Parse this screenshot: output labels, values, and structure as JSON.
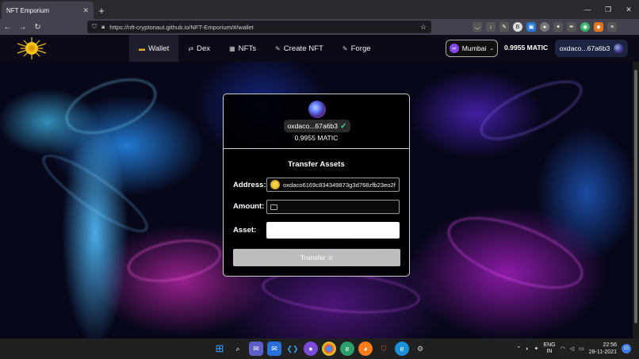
{
  "browser": {
    "tab_title": "NFT Emporium",
    "tab_close": "✕",
    "new_tab": "+",
    "url": "https://nft-cryptonaut.github.io/NFT-Emporium/#/wallet",
    "window_controls": {
      "minimize": "—",
      "restore": "❐",
      "close": "✕"
    },
    "nav": {
      "back": "←",
      "forward": "→",
      "reload": "↻"
    }
  },
  "header": {
    "menu": [
      {
        "label": "Wallet",
        "icon": "wallet-icon",
        "glyph": "▬"
      },
      {
        "label": "Dex",
        "icon": "swap-icon",
        "glyph": "⇄"
      },
      {
        "label": "NFTs",
        "icon": "image-icon",
        "glyph": "▦"
      },
      {
        "label": "Create NFT",
        "icon": "pencil-icon",
        "glyph": "✎"
      },
      {
        "label": "Forge",
        "icon": "pencil-icon",
        "glyph": "✎"
      }
    ],
    "network": "Mumbai",
    "balance": "0.9955 MATIC",
    "account": "oxdaco...67a6b3"
  },
  "wallet_card": {
    "address_short": "oxdaco...67a6b3",
    "balance": "0.9955 MATIC",
    "title": "Transfer Assets",
    "address_label": "Address:",
    "address_value": "oxdaco6169c834349873g3d768zfb23eo2f",
    "amount_label": "Amount:",
    "amount_value": "",
    "asset_label": "Asset:",
    "asset_value": "",
    "transfer_button": "Transfer"
  },
  "taskbar": {
    "lang_top": "ENG",
    "lang_bottom": "IN",
    "time": "22:56",
    "date": "28-11-2021",
    "notifications": "15"
  },
  "colors": {
    "accent": "#8247e5",
    "check": "#39d68a",
    "button": "#bdbdbd"
  }
}
